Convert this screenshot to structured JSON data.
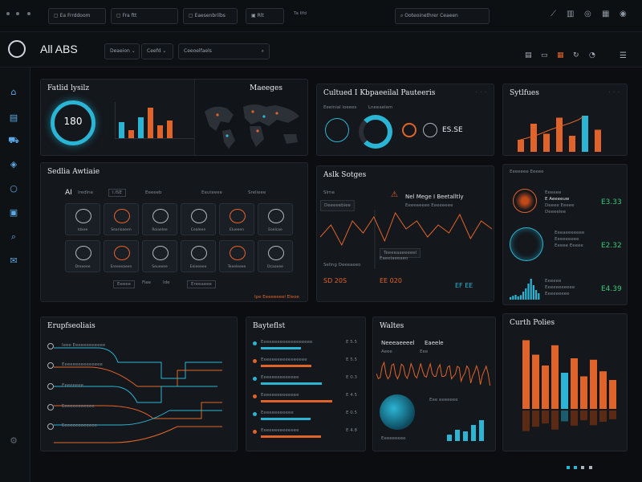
{
  "topbar": {
    "tab1": "Ea Frrddoom",
    "tab2": "Fra ftt",
    "tab3": "Eaesenbrilbs",
    "tab4": "Rlt",
    "tab5": "Ta llfd",
    "search_placeholder": "Ooteoinethrer Ceaeen"
  },
  "header": {
    "app_title": "All ABS",
    "filter1": "Deaeion",
    "filter2": "Ceefd",
    "search_placeholder": "Ceeoelfaels"
  },
  "panels": {
    "fleet": {
      "title": "Fatlid lysilz",
      "gauge_value": "180"
    },
    "maps": {
      "title": "Maeeges"
    },
    "cultured": {
      "title": "Cultued I Kbpaeeilal Pauteeris",
      "sub1": "Eeeinial loeees",
      "sub2": "Lneeaelem",
      "value": "ES.SE"
    },
    "skilles": {
      "title": "Sytlfues"
    },
    "sedtid": {
      "title": "Sedlia Awtiaie",
      "label_ai": "AI",
      "toolbar": [
        "Iredlne",
        "I.ISE",
        "Eeeeeb",
        "Eeuteeee",
        "Srelieee"
      ],
      "tiles": [
        "Idaee",
        "Searioaeen",
        "Roiaelee",
        "Cealeee",
        "Elueeen",
        "Eoelcae",
        "Dreeeee",
        "Ereeeeaeen",
        "Seueeee",
        "Eeieeeee",
        "Teeeleeee",
        "Dcaoeee"
      ],
      "footer": [
        "Eeeee",
        "Fiae",
        "Ide",
        "Ereeaeee"
      ],
      "link": "Ipe Eeeeeeeel Eleoe"
    },
    "alts": {
      "title": "Aslk Sotges",
      "label1": "Slrne",
      "label2": "Deeeeebiee",
      "alert": "Nel Mege I Beetalltly",
      "alert_sub": "Eeeeeeeee Eeeeeeee",
      "tooltip1": "Teeeeaaeeeeel",
      "tooltip2": "Eaeelaeeaeo",
      "stat_label": "Sellng Deeeaeeo",
      "stat1": "SD 20S",
      "stat2": "EE 020",
      "stat3": "EF EE"
    },
    "right_stack": {
      "header": "Eeeeeee Eeeee",
      "items": [
        {
          "lines": [
            "Eeeeee",
            "E Aeeeeuw",
            "Deeee Eeeee",
            "Deeeelee"
          ],
          "value": "E3.33"
        },
        {
          "lines": [
            "Eeeaeeeeeee",
            "Eeeeeeeee",
            "Eeeee Eeeee"
          ],
          "value": "E2.32"
        },
        {
          "lines": [
            "Eeeeee",
            "Eeeeeeeeeee",
            "Eeeeeeeee"
          ],
          "value": "E4.39"
        }
      ]
    },
    "erup": {
      "title": "Erupfseoliais",
      "items": [
        "Ieee Eeeeeeeeeeee",
        "Eeeeeeeeeeeeeee",
        "Eeeeeeee",
        "Eeeeeeeeeeee",
        "Eeeeeeeeeeeee"
      ]
    },
    "bayest": {
      "title": "Bayteflst",
      "rows": [
        {
          "label": "Eeeeeeeeeeeeeeeeeee",
          "value": "E 5.5"
        },
        {
          "label": "Eeeeeeeeeeeeeeeee",
          "value": "E 5.5"
        },
        {
          "label": "Eeeeeeeeeeeeee",
          "value": "E 0.3"
        },
        {
          "label": "Eeeeeeeeeeeeee",
          "value": "E 4.5"
        },
        {
          "label": "Eeeeeeeeeeee",
          "value": "E 0.5"
        },
        {
          "label": "Eeeeeeeeeeeeee",
          "value": "E 4.8"
        }
      ]
    },
    "waltes": {
      "title": "Waltes",
      "sub1": "Neeeaeeeel",
      "sub2": "Eaeele",
      "sub3": "Aeee",
      "sub4": "Eee",
      "foot1": "Eee eeeeeee",
      "foot2": "Eeeeeeeee"
    },
    "curthpolies": {
      "title": "Curth Polies"
    }
  },
  "colors": {
    "accent_orange": "#e0642a",
    "accent_cyan": "#2bb5d4",
    "accent_green": "#36c77a",
    "bg": "#0b0d10"
  },
  "chart_data": [
    {
      "type": "bar",
      "values": [
        30,
        70,
        45,
        85,
        40,
        90,
        55
      ]
    },
    {
      "type": "bar",
      "values": [
        8,
        12,
        15,
        10,
        14,
        25,
        35,
        50,
        65,
        45,
        30,
        20
      ]
    },
    {
      "type": "bar",
      "values": [
        95,
        75,
        60,
        88,
        50,
        70,
        45,
        68,
        52,
        40
      ]
    },
    {
      "type": "line",
      "values": [
        40,
        55,
        30,
        60,
        45,
        65,
        35,
        70,
        50,
        60,
        40,
        55,
        45,
        68,
        38,
        60,
        50
      ]
    }
  ]
}
